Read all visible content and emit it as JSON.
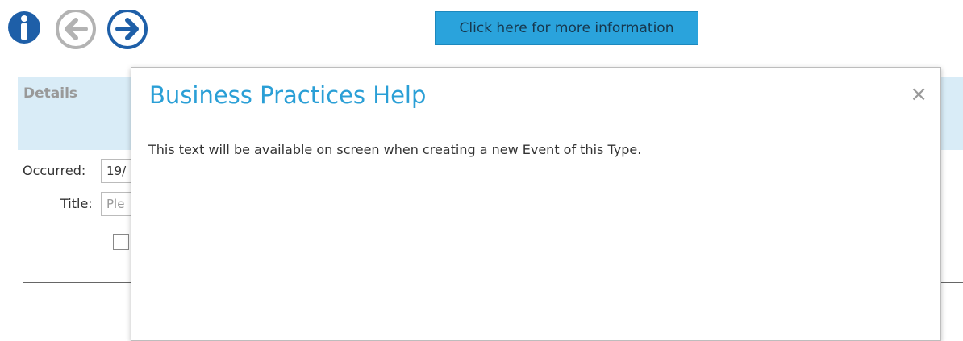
{
  "toolbar": {
    "info_icon": "info-icon",
    "back_icon": "arrow-left-icon",
    "forward_icon": "arrow-right-icon",
    "more_info_label": "Click here for more information"
  },
  "details": {
    "title": "Details",
    "occurred_label": "Occurred:",
    "occurred_value": "19/",
    "title_label": "Title:",
    "title_placeholder": "Ple"
  },
  "modal": {
    "title": "Business Practices Help",
    "close_glyph": "×",
    "body": "This text will be available on screen when creating a new Event of this Type."
  },
  "colors": {
    "accent": "#2aa3dc",
    "modal_title": "#2a9fd6",
    "panel_bg": "#d9ecf7",
    "icon_blue": "#1e5fa8",
    "icon_gray": "#b3b3b3"
  }
}
